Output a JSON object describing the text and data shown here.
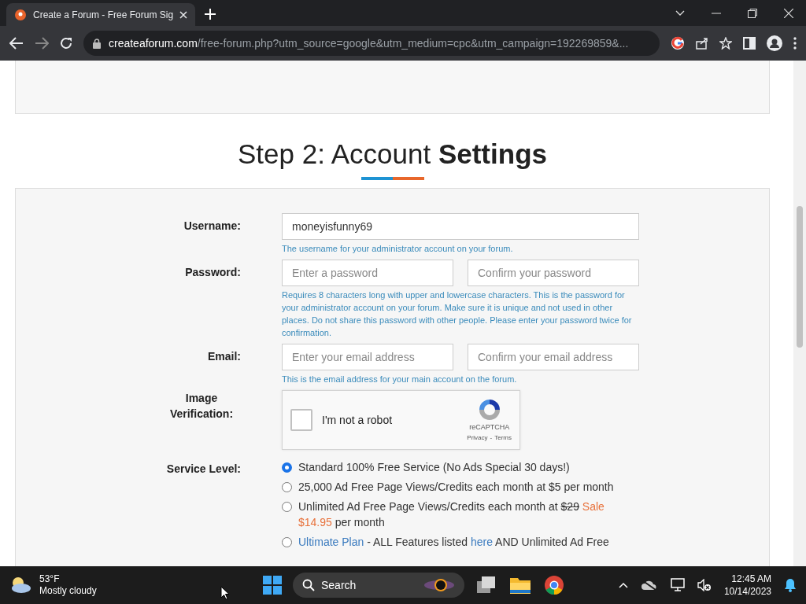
{
  "browser": {
    "tab": {
      "title": "Create a Forum - Free Forum Sig",
      "selected": true
    },
    "url": {
      "domain": "createaforum.com",
      "path": "/free-forum.php?utm_source=google&utm_medium=cpc&utm_campaign=192269859&..."
    }
  },
  "heading": {
    "plain": "Step 2: Account ",
    "bold": "Settings"
  },
  "form": {
    "username": {
      "label": "Username:",
      "value": "moneyisfunny69",
      "hint": "The username for your administrator account on your forum."
    },
    "password": {
      "label": "Password:",
      "placeholders": [
        "Enter a password",
        "Confirm your password"
      ],
      "hint": "Requires 8 characters long with upper and lowercase characters. This is the password for your administrator account on your forum. Make sure it is unique and not used in other places. Do not share this password with other people. Please enter your password twice for confirmation."
    },
    "email": {
      "label": "Email:",
      "placeholders": [
        "Enter your email address",
        "Confirm your email address"
      ],
      "hint": "This is the email address for your main account on the forum."
    },
    "captcha": {
      "label": "Image Verification:",
      "text": "I'm not a robot",
      "checked": false,
      "brand": "reCAPTCHA",
      "privacy": "Privacy",
      "separator": "-",
      "terms": "Terms"
    },
    "service": {
      "label": "Service Level:",
      "options": [
        {
          "selected": true,
          "parts": [
            {
              "kind": "text",
              "text": "Standard 100% Free Service (No Ads Special 30 days!)"
            }
          ]
        },
        {
          "selected": false,
          "parts": [
            {
              "kind": "text",
              "text": "25,000 Ad Free Page Views/Credits each month at $5 per month"
            }
          ]
        },
        {
          "selected": false,
          "parts": [
            {
              "kind": "text",
              "text": "Unlimited Ad Free Page Views/Credits each month at"
            },
            {
              "kind": "strike",
              "text": "$29"
            },
            {
              "kind": "sale",
              "text": "Sale $14.95"
            },
            {
              "kind": "text",
              "text": "per month"
            }
          ]
        },
        {
          "selected": false,
          "parts": [
            {
              "kind": "link",
              "text": "Ultimate Plan"
            },
            {
              "kind": "text",
              "text": "- ALL Features listed"
            },
            {
              "kind": "link",
              "text": "here"
            },
            {
              "kind": "text",
              "text": "AND Unlimited Ad Free"
            }
          ]
        }
      ]
    }
  },
  "taskbar": {
    "weather": {
      "temp": "53°F",
      "condition": "Mostly cloudy"
    },
    "search": {
      "placeholder": "Search"
    },
    "clock": {
      "time": "12:45 AM",
      "date": "10/14/2023"
    }
  }
}
